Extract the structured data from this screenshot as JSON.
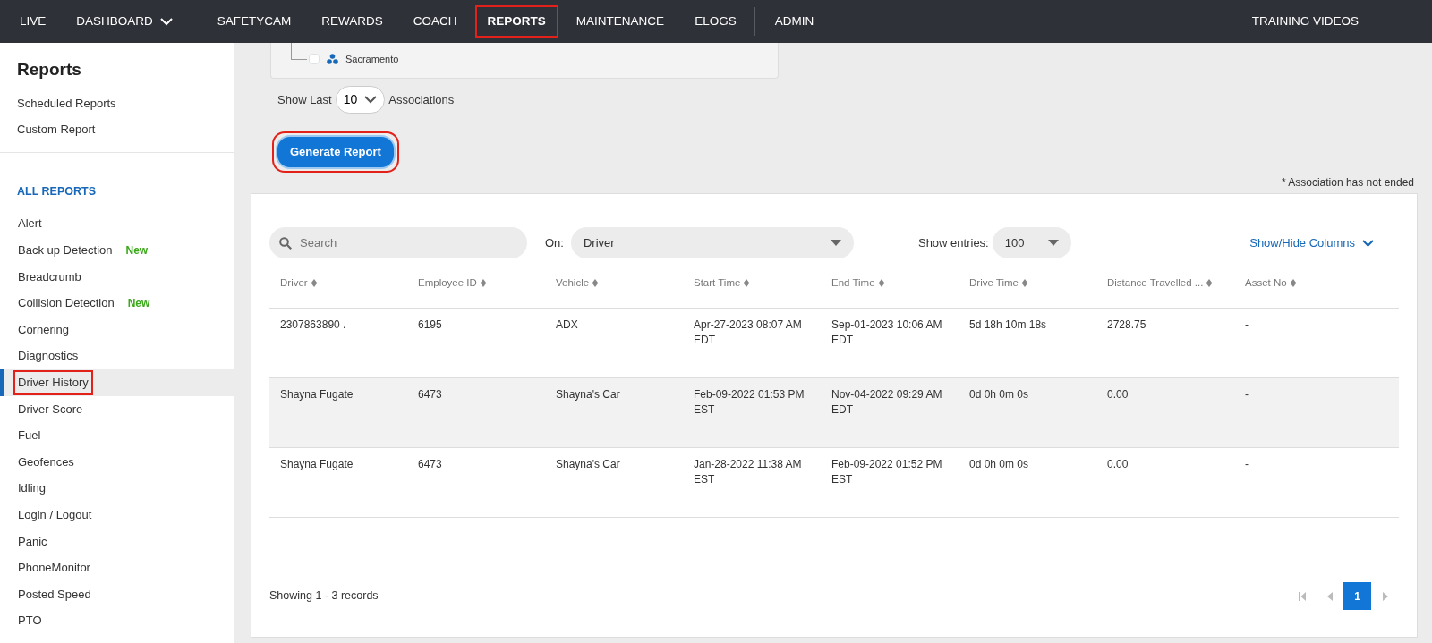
{
  "top_nav": {
    "items": [
      {
        "label": "LIVE",
        "kind": "link",
        "selected": false,
        "highlighted": false,
        "divider_before": false
      },
      {
        "label": "DASHBOARD",
        "kind": "dropdown",
        "selected": false,
        "highlighted": false,
        "divider_before": false
      },
      {
        "label": "SAFETYCAM",
        "kind": "link",
        "selected": false,
        "highlighted": false,
        "divider_before": false
      },
      {
        "label": "REWARDS",
        "kind": "link",
        "selected": false,
        "highlighted": false,
        "divider_before": false
      },
      {
        "label": "COACH",
        "kind": "link",
        "selected": false,
        "highlighted": false,
        "divider_before": false
      },
      {
        "label": "REPORTS",
        "kind": "link",
        "selected": true,
        "highlighted": true,
        "divider_before": false
      },
      {
        "label": "MAINTENANCE",
        "kind": "link",
        "selected": false,
        "highlighted": false,
        "divider_before": false
      },
      {
        "label": "ELOGS",
        "kind": "link",
        "selected": false,
        "highlighted": false,
        "divider_before": false
      },
      {
        "label": "ADMIN",
        "kind": "link",
        "selected": false,
        "highlighted": false,
        "divider_before": true
      }
    ],
    "right_link": "TRAINING VIDEOS"
  },
  "sidebar": {
    "title": "Reports",
    "links": [
      "Scheduled Reports",
      "Custom Report"
    ],
    "section_title": "ALL REPORTS",
    "items": [
      {
        "label": "Alert",
        "selected": false,
        "highlighted": false
      },
      {
        "label": "Back up Detection",
        "badge": "New",
        "selected": false,
        "highlighted": false
      },
      {
        "label": "Breadcrumb",
        "selected": false,
        "highlighted": false
      },
      {
        "label": "Collision Detection",
        "badge": "New",
        "selected": false,
        "highlighted": false
      },
      {
        "label": "Cornering",
        "selected": false,
        "highlighted": false
      },
      {
        "label": "Diagnostics",
        "selected": false,
        "highlighted": false
      },
      {
        "label": "Driver History",
        "selected": true,
        "highlighted": true
      },
      {
        "label": "Driver Score",
        "selected": false,
        "highlighted": false
      },
      {
        "label": "Fuel",
        "selected": false,
        "highlighted": false
      },
      {
        "label": "Geofences",
        "selected": false,
        "highlighted": false
      },
      {
        "label": "Idling",
        "selected": false,
        "highlighted": false
      },
      {
        "label": "Login / Logout",
        "selected": false,
        "highlighted": false
      },
      {
        "label": "Panic",
        "selected": false,
        "highlighted": false
      },
      {
        "label": "PhoneMonitor",
        "selected": false,
        "highlighted": false
      },
      {
        "label": "Posted Speed",
        "selected": false,
        "highlighted": false
      },
      {
        "label": "PTO",
        "selected": false,
        "highlighted": false
      }
    ]
  },
  "filter_tree": {
    "items": [
      {
        "label": "Sacramento",
        "checked": false
      }
    ]
  },
  "show_last": {
    "prefix": "Show Last",
    "value": "10",
    "suffix": "Associations"
  },
  "generate_button": {
    "label": "Generate Report",
    "highlighted": true
  },
  "note": "* Association has not ended",
  "table": {
    "search": {
      "placeholder": "Search"
    },
    "on": {
      "label": "On:",
      "value": "Driver"
    },
    "entries": {
      "label": "Show entries:",
      "value": "100"
    },
    "columns_toggle": "Show/Hide Columns",
    "columns": [
      "Driver",
      "Employee ID",
      "Vehicle",
      "Start Time",
      "End Time",
      "Drive Time",
      "Distance Travelled ...",
      "Asset No"
    ],
    "rows": [
      {
        "cells": [
          "2307863890 .",
          "6195",
          "ADX",
          "Apr-27-2023 08:07 AM EDT",
          "Sep-01-2023 10:06 AM EDT",
          "5d 18h 10m 18s",
          "2728.75",
          "-"
        ],
        "hovered": false
      },
      {
        "cells": [
          "Shayna Fugate",
          "6473",
          "Shayna's Car",
          "Feb-09-2022 01:53 PM EST",
          "Nov-04-2022 09:29 AM EDT",
          "0d 0h 0m 0s",
          "0.00",
          "-"
        ],
        "hovered": true
      },
      {
        "cells": [
          "Shayna Fugate",
          "6473",
          "Shayna's Car",
          "Jan-28-2022 11:38 AM EST",
          "Feb-09-2022 01:52 PM EST",
          "0d 0h 0m 0s",
          "0.00",
          "-"
        ],
        "hovered": false
      }
    ],
    "footer": "Showing 1 - 3 records",
    "pagination": {
      "pages": [
        {
          "label": "1",
          "selected": true
        }
      ]
    }
  }
}
